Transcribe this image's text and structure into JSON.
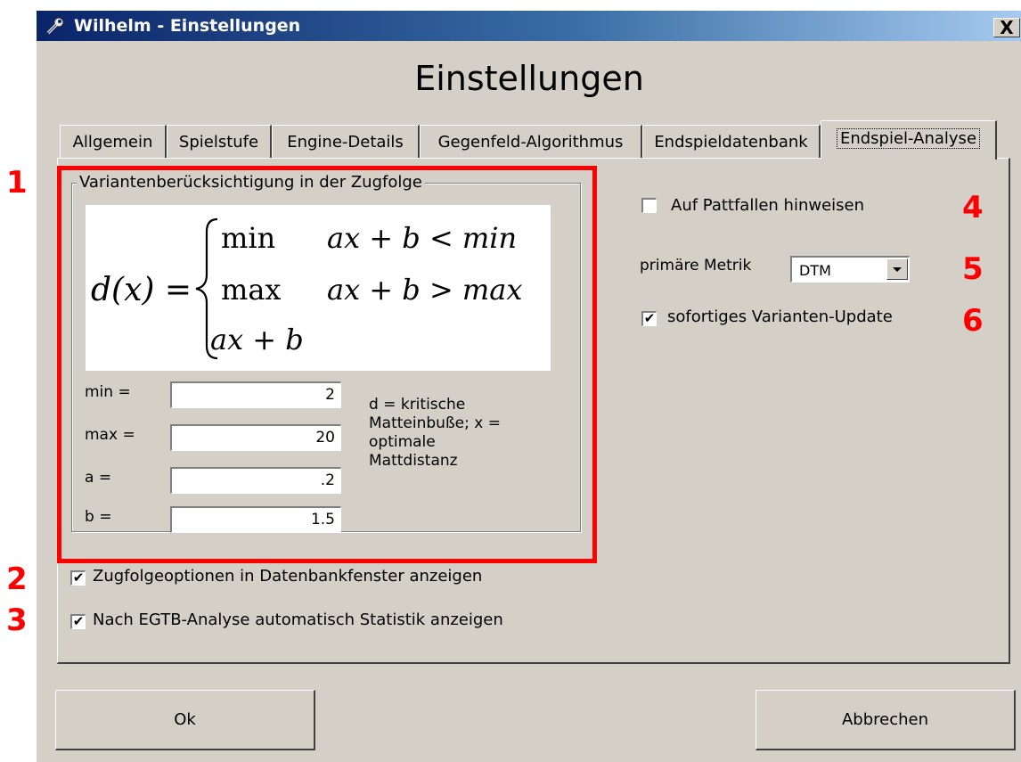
{
  "window": {
    "title": "Wilhelm - Einstellungen",
    "close_glyph": "X"
  },
  "heading": "Einstellungen",
  "tabs": [
    {
      "label": "Allgemein",
      "active": false
    },
    {
      "label": "Spielstufe",
      "active": false
    },
    {
      "label": "Engine-Details",
      "active": false
    },
    {
      "label": "Gegenfeld-Algorithmus",
      "active": false
    },
    {
      "label": "Endspieldatenbank",
      "active": false
    },
    {
      "label": "Endspiel-Analyse",
      "active": true
    }
  ],
  "group": {
    "legend": "Variantenberücksichtigung in der Zugfolge",
    "formula": {
      "lhs": "d(x) =",
      "rows": [
        {
          "value": "min",
          "condition": "ax + b < min"
        },
        {
          "value": "max",
          "condition": "ax + b > max"
        },
        {
          "value": "ax + b",
          "condition": ""
        }
      ]
    },
    "params": [
      {
        "label": "min =",
        "value": "2"
      },
      {
        "label": "max =",
        "value": "20"
      },
      {
        "label": "a =",
        "value": ".2"
      },
      {
        "label": "b =",
        "value": "1.5"
      }
    ],
    "description": "d = kritische Matteinbuße; x = optimale Mattdistanz"
  },
  "left_checks": [
    {
      "label": "Zugfolgeoptionen in Datenbankfenster anzeigen",
      "checked": true
    },
    {
      "label": "Nach EGTB-Analyse automatisch Statistik anzeigen",
      "checked": true
    }
  ],
  "right": {
    "pattfallen": {
      "label": "Auf Pattfallen hinweisen",
      "checked": false
    },
    "metric_label": "primäre Metrik",
    "metric_value": "DTM",
    "update": {
      "label": "sofortiges Varianten-Update",
      "checked": true
    }
  },
  "buttons": {
    "ok": "Ok",
    "cancel": "Abbrechen"
  },
  "annotations": [
    "1",
    "2",
    "3",
    "4",
    "5",
    "6"
  ],
  "colors": {
    "annotation": "#ff0000",
    "face": "#d4d0c8",
    "title_start": "#0a246a",
    "title_end": "#a6caf0"
  }
}
